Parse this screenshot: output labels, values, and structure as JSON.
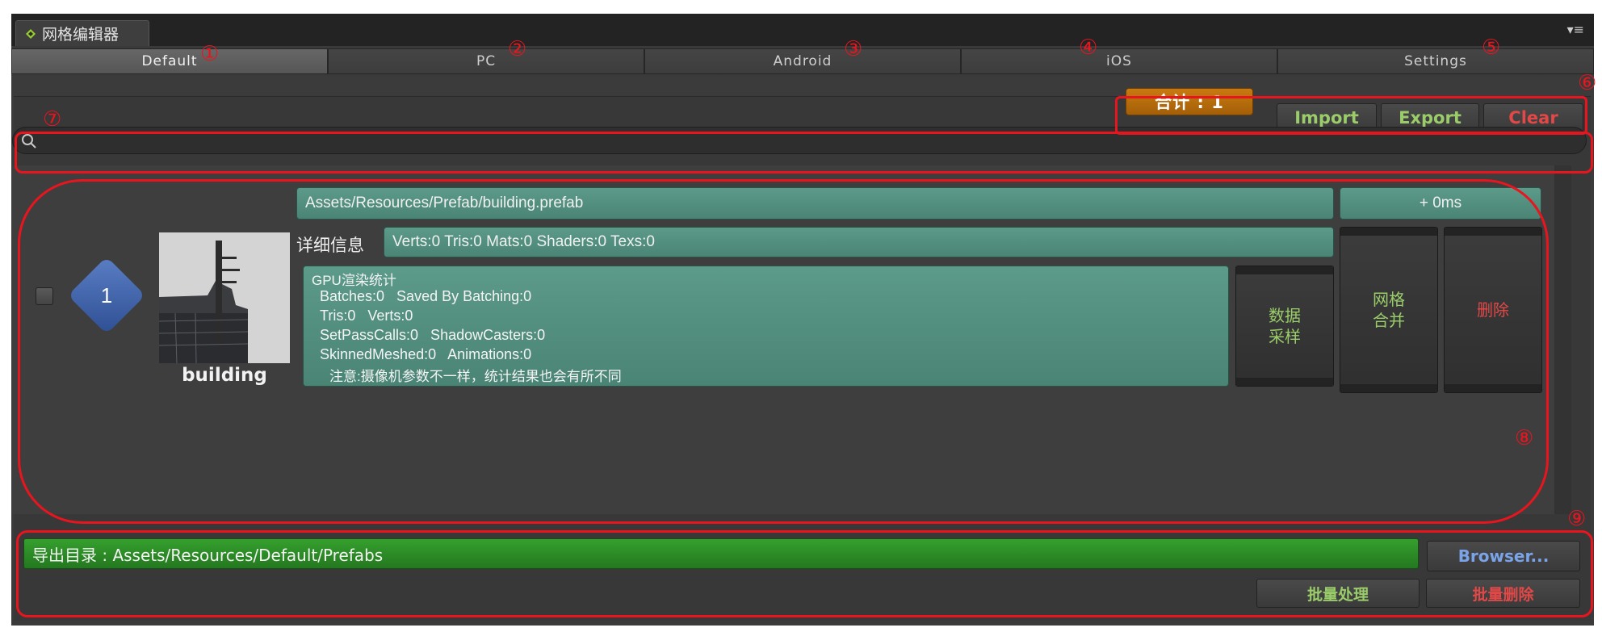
{
  "window": {
    "title": "网格编辑器"
  },
  "tabs": [
    {
      "label": "Default",
      "marker": "①",
      "active": true
    },
    {
      "label": "PC",
      "marker": "②"
    },
    {
      "label": "Android",
      "marker": "③"
    },
    {
      "label": "iOS",
      "marker": "④"
    },
    {
      "label": "Settings",
      "marker": "⑤"
    }
  ],
  "header_markers": {
    "actions": "⑥",
    "search": "⑦",
    "list": "⑧",
    "footer": "⑨"
  },
  "actions": {
    "count_label": "合计 : 1",
    "import_label": "Import",
    "export_label": "Export",
    "clear_label": "Clear"
  },
  "search": {
    "value": ""
  },
  "item": {
    "index": "1",
    "name": "building",
    "path": "Assets/Resources/Prefab/building.prefab",
    "time": "+ 0ms",
    "detail_label": "详细信息",
    "detail_value": "Verts:0 Tris:0 Mats:0 Shaders:0 Texs:0",
    "gpu": {
      "title": "GPU渲染统计",
      "line1": "Batches:0   Saved By Batching:0",
      "line2": "Tris:0   Verts:0",
      "line3": "SetPassCalls:0   ShadowCasters:0",
      "line4": "SkinnedMeshed:0   Animations:0",
      "note": "注意:摄像机参数不一样，统计结果也会有所不同"
    },
    "sample_button": [
      "数据",
      "采样"
    ],
    "merge_button": [
      "网格",
      "合并"
    ],
    "delete_button": "删除"
  },
  "footer": {
    "export_dir": "导出目录 : Assets/Resources/Default/Prefabs",
    "browse_label": "Browser...",
    "batch_process_label": "批量处理",
    "batch_delete_label": "批量删除"
  },
  "colors": {
    "accent_orange": "#c97a10",
    "teal": "#4f8a7a",
    "export_green": "#2f8f2a",
    "text_green": "#9acd6a",
    "text_red": "#e24848",
    "text_blue": "#7aa3e8",
    "annotation_red": "#e8151f"
  }
}
